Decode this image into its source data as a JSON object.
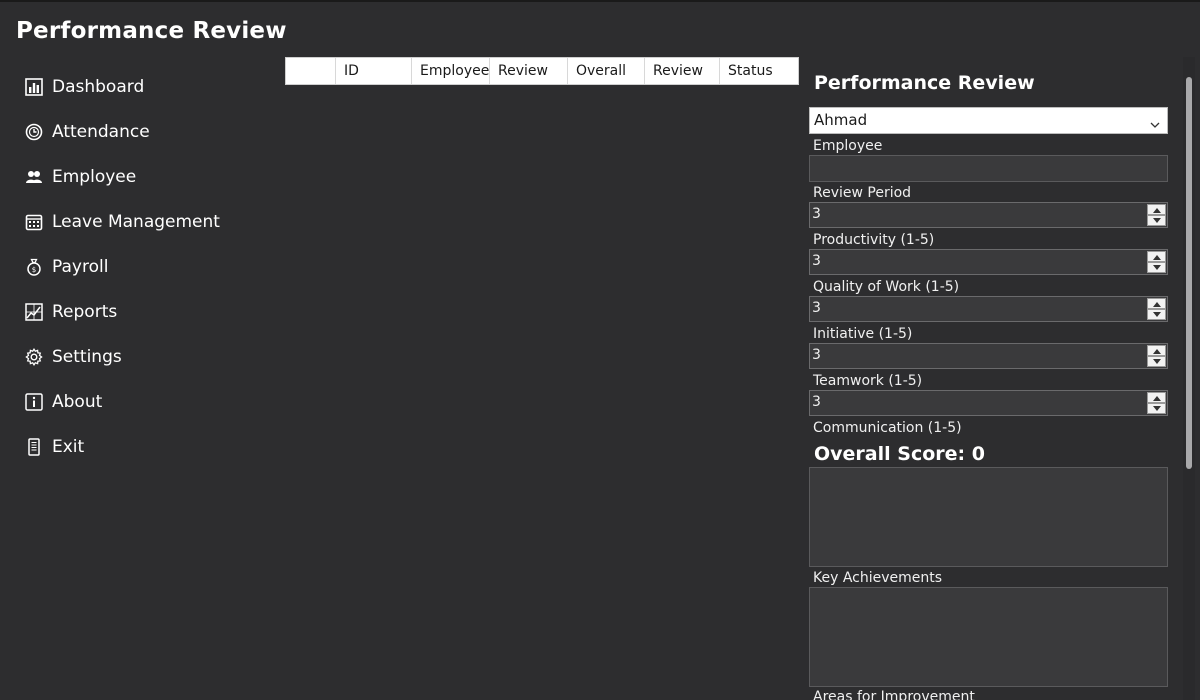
{
  "app": {
    "title": "Performance Review"
  },
  "sidebar": {
    "items": [
      {
        "label": "Dashboard",
        "icon": "chart-bar-icon"
      },
      {
        "label": "Attendance",
        "icon": "clock-icon"
      },
      {
        "label": "Employee",
        "icon": "people-icon"
      },
      {
        "label": "Leave Management",
        "icon": "calendar-icon"
      },
      {
        "label": "Payroll",
        "icon": "money-bag-icon"
      },
      {
        "label": "Reports",
        "icon": "report-chart-icon"
      },
      {
        "label": "Settings",
        "icon": "gear-icon"
      },
      {
        "label": "About",
        "icon": "info-icon"
      },
      {
        "label": "Exit",
        "icon": "exit-icon"
      }
    ]
  },
  "table": {
    "columns": [
      "",
      "ID",
      "Employee",
      "Review",
      "Overall",
      "Review",
      "Status"
    ],
    "rows": []
  },
  "form": {
    "title": "Performance Review",
    "employee_select": "Ahmad",
    "labels": {
      "employee": "Employee",
      "review_period": "Review Period",
      "productivity": "Productivity (1-5)",
      "quality": "Quality of Work (1-5)",
      "initiative": "Initiative (1-5)",
      "teamwork": "Teamwork (1-5)",
      "communication": "Communication (1-5)",
      "key_achievements": "Key Achievements",
      "areas_improvement": "Areas for Improvement"
    },
    "review_period": "",
    "spin_values": [
      "3",
      "3",
      "3",
      "3",
      "3"
    ],
    "overall_score": "Overall Score: 0"
  }
}
